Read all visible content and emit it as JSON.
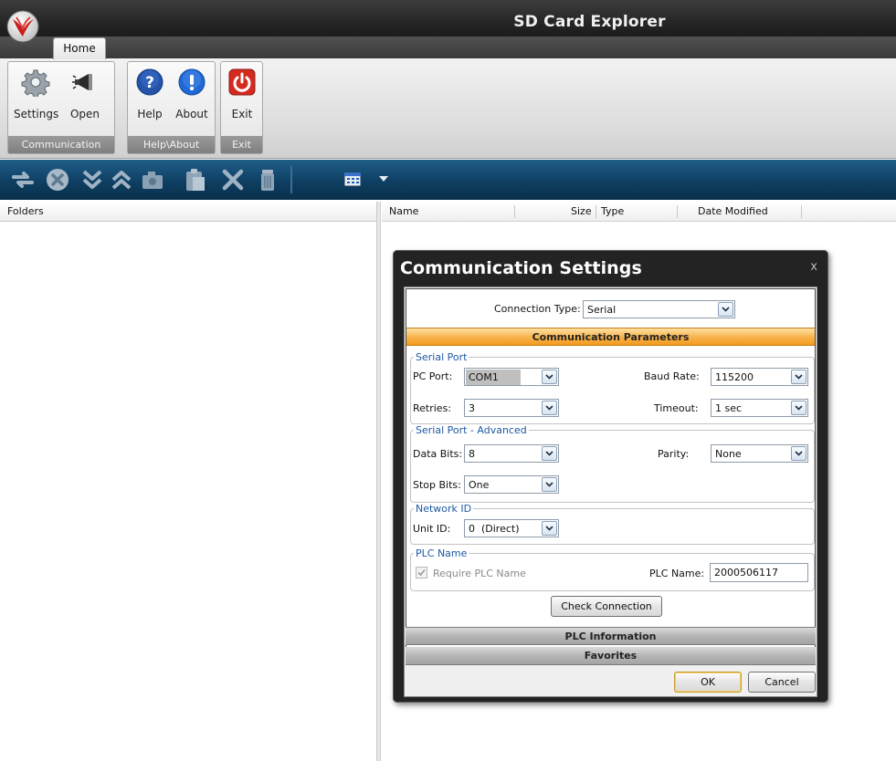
{
  "app": {
    "title": "SD Card Explorer",
    "tab_home": "Home"
  },
  "ribbon": {
    "groups": [
      {
        "label": "Communication",
        "buttons": [
          "Settings",
          "Open"
        ]
      },
      {
        "label": "Help\\About",
        "buttons": [
          "Help",
          "About"
        ]
      },
      {
        "label": "Exit",
        "buttons": [
          "Exit"
        ]
      }
    ]
  },
  "toolbar": {
    "icons": [
      "refresh-icon",
      "stop-icon",
      "download-icon",
      "upload-icon",
      "camera-icon",
      "paste-icon",
      "delete-icon",
      "trash-icon",
      "view-options-icon",
      "dropdown-arrow-icon"
    ]
  },
  "folders_pane": {
    "header": "Folders"
  },
  "files_pane": {
    "columns": [
      "Name",
      "Size",
      "Type",
      "Date Modified"
    ]
  },
  "dialog": {
    "title": "Communication Settings",
    "close_glyph": "x",
    "connection_type_label": "Connection Type:",
    "connection_type_value": "Serial",
    "section_params": "Communication Parameters",
    "serial_port": {
      "legend": "Serial Port",
      "pc_port_label": "PC Port:",
      "pc_port_value": "COM1",
      "baud_rate_label": "Baud Rate:",
      "baud_rate_value": "115200",
      "retries_label": "Retries:",
      "retries_value": "3",
      "timeout_label": "Timeout:",
      "timeout_value": "1 sec"
    },
    "serial_advanced": {
      "legend": "Serial Port - Advanced",
      "data_bits_label": "Data Bits:",
      "data_bits_value": "8",
      "parity_label": "Parity:",
      "parity_value": "None",
      "stop_bits_label": "Stop Bits:",
      "stop_bits_value": "One"
    },
    "network_id": {
      "legend": "Network ID",
      "unit_id_label": "Unit ID:",
      "unit_id_value": "0  (Direct)"
    },
    "plc_name": {
      "legend": "PLC Name",
      "require_label": "Require PLC Name",
      "require_checked": true,
      "plc_name_label": "PLC Name:",
      "plc_name_value": "2000506117"
    },
    "check_connection": "Check Connection",
    "section_plc_info": "PLC Information",
    "section_favorites": "Favorites",
    "ok": "OK",
    "cancel": "Cancel"
  },
  "colors": {
    "titlebar": "#262626",
    "toolbar_blue": "#0e3f63",
    "section_orange": "#f5a623",
    "section_gray": "#a8a8a8",
    "legend_blue": "#1c5aa3"
  }
}
